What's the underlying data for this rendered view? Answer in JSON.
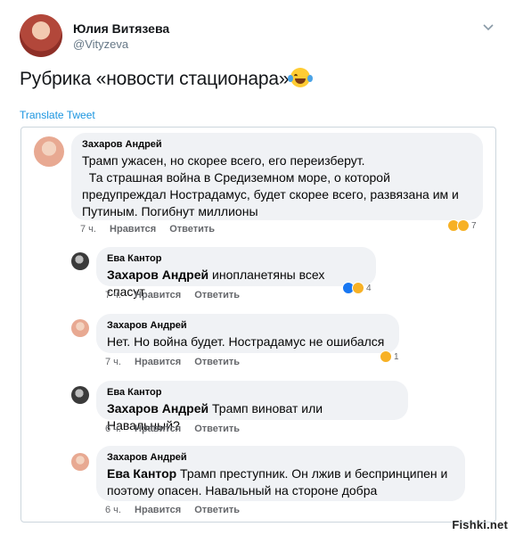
{
  "tweet": {
    "author_name": "Юлия Витязева",
    "author_handle": "@Vityzeva",
    "text": "Рубрика «новости стационара»",
    "emoji_icon": "laughing-tears-icon",
    "translate_label": "Translate Tweet"
  },
  "comments": [
    {
      "author": "Захаров Андрей",
      "mention": "",
      "text": "Трамп ужасен, но скорее всего, его переизберут.",
      "text2": "  Та страшная война в Средиземном море, о которой",
      "text3": "предупреждал Нострадамус, будет скорее всего, развязана им и",
      "text4": "Путиным. Погибнут миллионы",
      "time": "7 ч.",
      "like": "Нравится",
      "reply": "Ответить",
      "reactions_count": "7",
      "reaction_icons": [
        "haha-icon",
        "wow-icon"
      ]
    },
    {
      "author": "Ева Кантор",
      "mention": "Захаров Андрей",
      "text": " инопланетяны всех спасут",
      "time": "7 ч.",
      "like": "Нравится",
      "reply": "Ответить",
      "reactions_count": "4",
      "reaction_icons": [
        "like-icon",
        "haha-icon"
      ]
    },
    {
      "author": "Захаров Андрей",
      "mention": "",
      "text": "Нет. Но война будет. Нострадамус не ошибался",
      "time": "7 ч.",
      "like": "Нравится",
      "reply": "Ответить",
      "reactions_count": "1",
      "reaction_icons": [
        "haha-icon"
      ]
    },
    {
      "author": "Ева Кантор",
      "mention": "Захаров Андрей",
      "text": " Трамп виноват или Навальный?",
      "time": "6 ч.",
      "like": "Нравится",
      "reply": "Ответить"
    },
    {
      "author": "Захаров Андрей",
      "mention": "Ева Кантор",
      "text": " Трамп преступник. Он лжив и беспринципен и",
      "text2": "поэтому опасен. Навальный на стороне добра",
      "time": "6 ч.",
      "like": "Нравится",
      "reply": "Ответить"
    }
  ],
  "watermark": "Fishki.net",
  "colors": {
    "bubble": "#f0f2f5",
    "link_blue": "#1b95e0",
    "like_blue": "#1877f2",
    "haha_yellow": "#f7b125"
  }
}
